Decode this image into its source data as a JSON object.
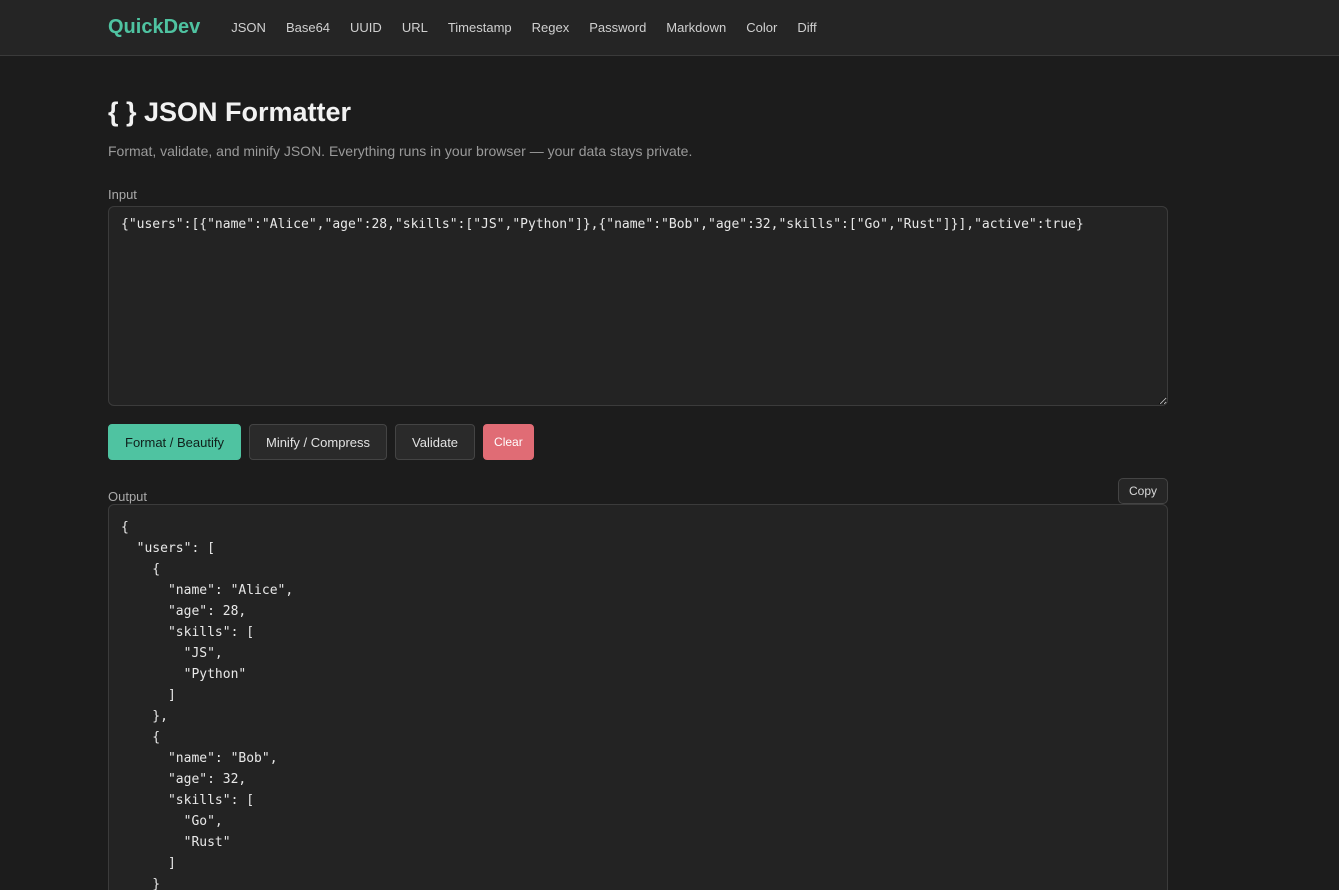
{
  "nav": {
    "brand": "QuickDev",
    "links": [
      "JSON",
      "Base64",
      "UUID",
      "URL",
      "Timestamp",
      "Regex",
      "Password",
      "Markdown",
      "Color",
      "Diff"
    ]
  },
  "page": {
    "title": "{ } JSON Formatter",
    "subtitle": "Format, validate, and minify JSON. Everything runs in your browser — your data stays private."
  },
  "input": {
    "label": "Input",
    "value": "{\"users\":[{\"name\":\"Alice\",\"age\":28,\"skills\":[\"JS\",\"Python\"]},{\"name\":\"Bob\",\"age\":32,\"skills\":[\"Go\",\"Rust\"]}],\"active\":true}"
  },
  "actions": {
    "format": "Format / Beautify",
    "minify": "Minify / Compress",
    "validate": "Validate",
    "clear": "Clear"
  },
  "output": {
    "label": "Output",
    "copy": "Copy",
    "text": "{\n  \"users\": [\n    {\n      \"name\": \"Alice\",\n      \"age\": 28,\n      \"skills\": [\n        \"JS\",\n        \"Python\"\n      ]\n    },\n    {\n      \"name\": \"Bob\",\n      \"age\": 32,\n      \"skills\": [\n        \"Go\",\n        \"Rust\"\n      ]\n    }\n  ],\n  \"active\": true\n}"
  },
  "colors": {
    "accent": "#4fc3a1",
    "danger": "#e06c75",
    "background": "#1c1c1c"
  }
}
